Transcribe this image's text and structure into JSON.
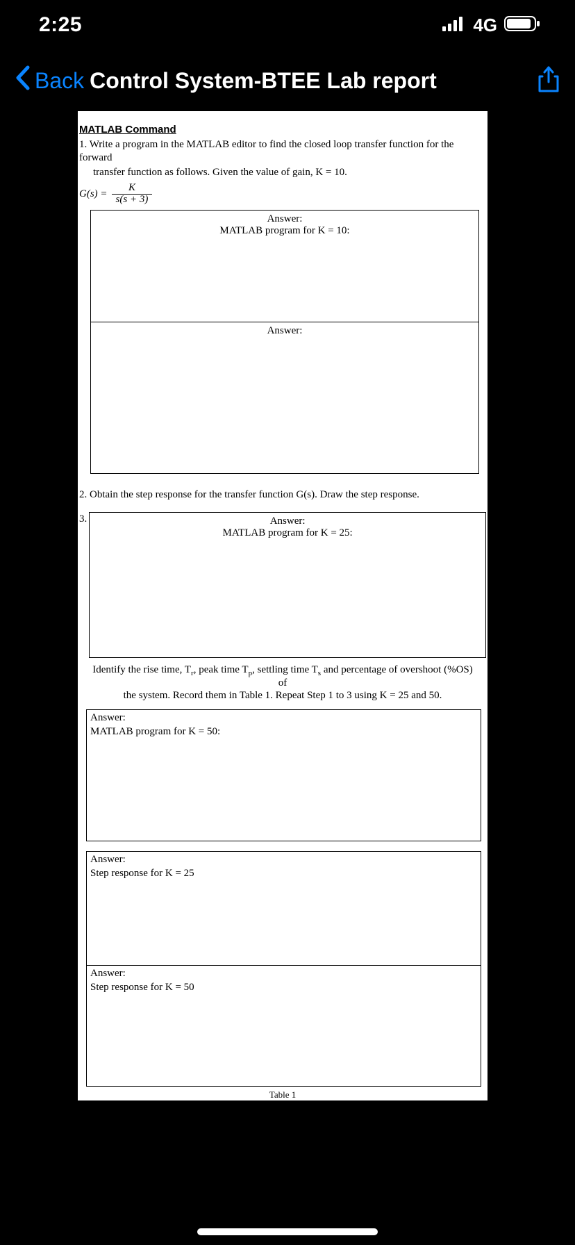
{
  "status": {
    "time": "2:25",
    "network_label": "4G"
  },
  "nav": {
    "back_label": "Back",
    "title": "Control System-BTEE Lab report"
  },
  "doc": {
    "heading": "MATLAB Command",
    "q1_line1": "1. Write a program in the MATLAB editor to find the closed loop transfer function for the forward",
    "q1_line2": "transfer function as follows. Given the value of gain, K = 10.",
    "formula_lhs": "G(s) =",
    "formula_num": "K",
    "formula_den": "s(s + 3)",
    "ans_label": "Answer:",
    "ans_k10": "MATLAB program for K = 10:",
    "q2": "2. Obtain the step response for the transfer function G(s). Draw the step response.",
    "q3_num": "3.",
    "ans_k25": "MATLAB program for K = 25:",
    "identify_l1": "Identify the rise time, Tr, peak time Tp, settling time Ts and percentage of overshoot (%OS) of",
    "identify_l2": "the system. Record them in Table 1. Repeat Step 1 to 3 using K = 25 and 50.",
    "ans_k50": "MATLAB program for K = 50:",
    "ans_step25": "Step response for K = 25",
    "ans_step50": "Step response for K = 50",
    "footer": "Table 1"
  }
}
